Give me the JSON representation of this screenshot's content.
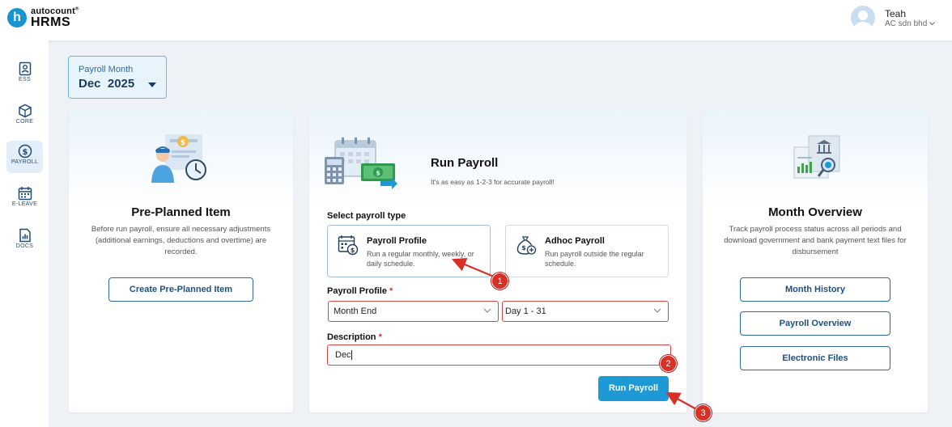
{
  "brand": {
    "small": "autocount",
    "mark": "®",
    "big": "HRMS",
    "logo_letter": "h"
  },
  "user": {
    "name": "Teah",
    "company": "AC sdn bhd"
  },
  "sidebar": {
    "items": [
      {
        "label": "ESS",
        "icon": "user-card-icon"
      },
      {
        "label": "CORE",
        "icon": "cube-icon"
      },
      {
        "label": "PAYROLL",
        "icon": "dollar-circle-icon",
        "active": true
      },
      {
        "label": "E-LEAVE",
        "icon": "calendar-icon"
      },
      {
        "label": "DOCS",
        "icon": "document-chart-icon"
      }
    ]
  },
  "payroll_month": {
    "label": "Payroll Month",
    "value": "Dec  2025"
  },
  "pre_planned": {
    "title": "Pre-Planned Item",
    "description": "Before run payroll, ensure all necessary adjustments (additional earnings, deductions and overtime) are recorded.",
    "button": "Create Pre-Planned Item"
  },
  "run_payroll": {
    "title": "Run Payroll",
    "subtitle": "It's as easy as 1-2-3 for accurate payroll!",
    "select_type_label": "Select payroll type",
    "types": [
      {
        "title": "Payroll Profile",
        "description": "Run a regular monthly, weekly, or daily schedule.",
        "selected": true
      },
      {
        "title": "Adhoc Payroll",
        "description": "Run payroll outside the regular schedule.",
        "selected": false
      }
    ],
    "profile_label": "Payroll Profile",
    "profile_value": "Month End",
    "period_value": "Day 1 - 31",
    "description_label": "Description",
    "description_value": "Dec",
    "required_mark": "*",
    "run_button": "Run Payroll"
  },
  "month_overview": {
    "title": "Month Overview",
    "description": "Track payroll process status across all periods and download government and bank payment text files for disbursement",
    "buttons": [
      "Month History",
      "Payroll Overview",
      "Electronic Files"
    ]
  },
  "annotations": {
    "steps": [
      "1",
      "2",
      "3"
    ],
    "color": "#d93025"
  },
  "colors": {
    "accent": "#1d9ad6",
    "brand_dark": "#1a3c5e",
    "highlight": "#d94848"
  }
}
